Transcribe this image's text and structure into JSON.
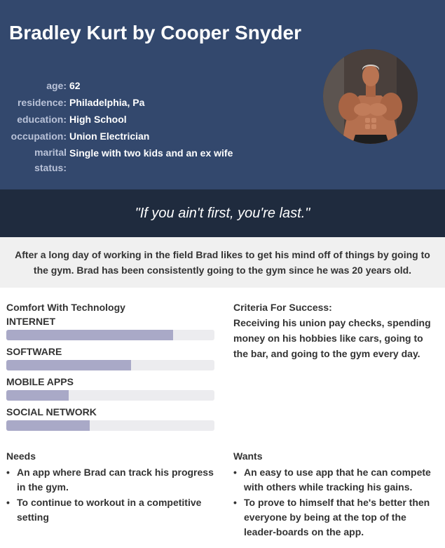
{
  "persona": {
    "name": "Bradley Kurt by Cooper Snyder",
    "info": [
      {
        "label": "age:",
        "value": "62"
      },
      {
        "label": "residence:",
        "value": "Philadelphia, Pa"
      },
      {
        "label": "education:",
        "value": "High School"
      },
      {
        "label": "occupation:",
        "value": "Union Electrician"
      },
      {
        "label": "marital status:",
        "value": "Single with two kids and an ex wife"
      }
    ],
    "quote": "\"If you ain't first, you're last.\"",
    "bio": "After a long day of working in the field Brad likes to get his mind off of things by going to the gym. Brad has been consistently going to the gym since he was 20 years old."
  },
  "technology": {
    "title": "Comfort With Technology",
    "skills": [
      {
        "label": "INTERNET",
        "level": 0.8
      },
      {
        "label": "SOFTWARE",
        "level": 0.6
      },
      {
        "label": "MOBILE APPS",
        "level": 0.3
      },
      {
        "label": "SOCIAL NETWORK",
        "level": 0.4
      }
    ]
  },
  "criteria": {
    "title": "Criteria For Success:",
    "text": "Receiving his union pay checks, spending money on his hobbies like cars, going to the bar, and going to the gym every day."
  },
  "needs": {
    "title": "Needs",
    "items": [
      "An app where Brad can track his progress in the gym.",
      "To continue to workout in a competitive setting"
    ]
  },
  "wants": {
    "title": "Wants",
    "items": [
      "An easy to use app that he can compete with others while tracking his gains.",
      "To prove to himself that he's better then everyone by being at the top of the leader-boards on the app."
    ]
  },
  "colors": {
    "header_bg": "#33486d",
    "quote_bg": "#1f2b3e",
    "bar_fill": "#a9a9c7",
    "bar_track": "#ececef"
  }
}
